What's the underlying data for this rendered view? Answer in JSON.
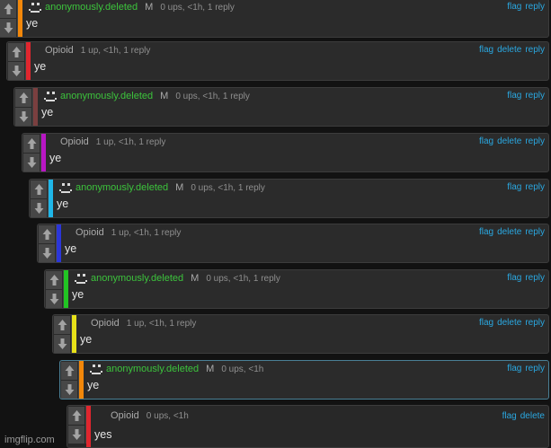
{
  "thread": {
    "comments": [
      {
        "user": "anonymously.deleted",
        "anon": true,
        "mod": "M",
        "stats": "0 ups, <1h, 1 reply",
        "actions": [
          "flag",
          "reply"
        ],
        "text": "ye",
        "color": "#f2870a"
      },
      {
        "user": "Opioid",
        "anon": false,
        "mod": "",
        "stats": "1 up, <1h, 1 reply",
        "actions": [
          "flag",
          "delete",
          "reply"
        ],
        "text": "ye",
        "color": "#e0262e"
      },
      {
        "user": "anonymously.deleted",
        "anon": true,
        "mod": "M",
        "stats": "0 ups, <1h, 1 reply",
        "actions": [
          "flag",
          "reply"
        ],
        "text": "ye",
        "color": "#7a3f3f"
      },
      {
        "user": "Opioid",
        "anon": false,
        "mod": "",
        "stats": "1 up, <1h, 1 reply",
        "actions": [
          "flag",
          "delete",
          "reply"
        ],
        "text": "ye",
        "color": "#b816c4"
      },
      {
        "user": "anonymously.deleted",
        "anon": true,
        "mod": "M",
        "stats": "0 ups, <1h, 1 reply",
        "actions": [
          "flag",
          "reply"
        ],
        "text": "ye",
        "color": "#1fb6e8"
      },
      {
        "user": "Opioid",
        "anon": false,
        "mod": "",
        "stats": "1 up, <1h, 1 reply",
        "actions": [
          "flag",
          "delete",
          "reply"
        ],
        "text": "ye",
        "color": "#2b36d8"
      },
      {
        "user": "anonymously.deleted",
        "anon": true,
        "mod": "M",
        "stats": "0 ups, <1h, 1 reply",
        "actions": [
          "flag",
          "reply"
        ],
        "text": "ye",
        "color": "#22c523"
      },
      {
        "user": "Opioid",
        "anon": false,
        "mod": "",
        "stats": "1 up, <1h, 1 reply",
        "actions": [
          "flag",
          "delete",
          "reply"
        ],
        "text": "ye",
        "color": "#e8e219"
      },
      {
        "user": "anonymously.deleted",
        "anon": true,
        "mod": "M",
        "stats": "0 ups, <1h",
        "actions": [
          "flag",
          "reply"
        ],
        "text": "ye",
        "color": "#f2870a"
      },
      {
        "user": "Opioid",
        "anon": false,
        "mod": "",
        "stats": "0 ups, <1h",
        "actions": [
          "flag",
          "delete"
        ],
        "text": "yes",
        "color": "#e0262e"
      }
    ]
  },
  "icons": {
    "upvote": "arrow-up-icon",
    "downvote": "arrow-down-icon",
    "avatar": "pixel-face-icon"
  },
  "watermark": "imgflip.com"
}
